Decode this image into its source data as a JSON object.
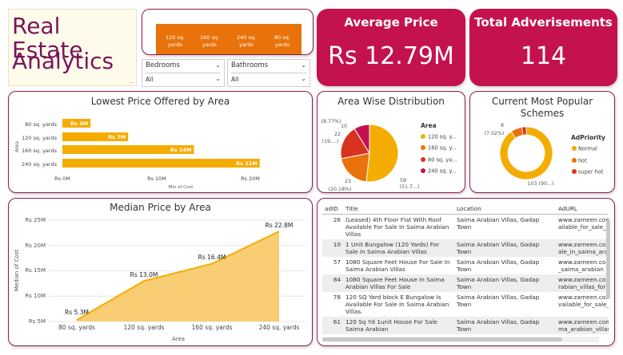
{
  "header": {
    "title_line1": "Real Estate",
    "title_line2": "Analytics",
    "title_footnote": "..."
  },
  "area_slicer": {
    "buttons": [
      "120 sq.\nyards",
      "160 sq.\nyards",
      "240 sq.\nyards",
      "80 sq.\nyards"
    ]
  },
  "filters": {
    "bedrooms": {
      "label": "Bedrooms",
      "value": "All"
    },
    "bathrooms": {
      "label": "Bathrooms",
      "value": "All"
    }
  },
  "kpis": {
    "average_price": {
      "label": "Average Price",
      "value": "Rs 12.79M"
    },
    "total_ads": {
      "label": "Total Adverisements",
      "value": "114"
    }
  },
  "colors": {
    "accent": "#c4124f",
    "border": "#8e1a4c",
    "bar": "#f5ac00",
    "slicer": "#e9720a",
    "title": "#7a1559"
  },
  "lowest_price": {
    "title": "Lowest Price Offered by Area",
    "ylabel": "Area",
    "xlabel": "Min of Cost",
    "x_ticks": [
      "Rs 0M",
      "Rs 10M",
      "Rs 20M"
    ],
    "categories": [
      "80 sq. yards",
      "120 sq. yards",
      "160 sq. yards",
      "240 sq. yards"
    ],
    "labels": [
      "Rs 3M",
      "Rs 7M",
      "Rs 14M",
      "Rs 21M"
    ]
  },
  "area_distribution": {
    "title": "Area Wise Distribution",
    "legend_title": "Area",
    "legend": [
      "120 sq. y...",
      "160 sq. y...",
      "80 sq. ya...",
      "240 sq. y..."
    ],
    "labels": {
      "s120": [
        "59",
        "(51.7...)"
      ],
      "s160": [
        "23",
        "(20.18%)"
      ],
      "s80": [
        "22",
        "(19....)"
      ],
      "s240": [
        "10",
        "(8.77%)"
      ]
    }
  },
  "popular_schemes": {
    "title_line1": "Current Most Popular",
    "title_line2": "Schemes",
    "legend_title": "AdPriority",
    "legend": [
      "Normal",
      "hot",
      "super hot"
    ],
    "labels": {
      "normal": "103 (90...)",
      "hot": "8",
      "hot_pct": "(7.02%)"
    }
  },
  "median_price": {
    "title": "Median Price by Area",
    "ylabel": "Median of Cost",
    "xlabel": "Area",
    "y_ticks": [
      "Rs 25M",
      "Rs 20M",
      "Rs 15M",
      "Rs 10M",
      "Rs 5M"
    ],
    "categories": [
      "80 sq. yards",
      "120 sq. yards",
      "160 sq. yards",
      "240 sq. yards"
    ],
    "labels": [
      "Rs 5.3M",
      "Rs 13.0M",
      "Rs 16.4M",
      "Rs 22.8M"
    ]
  },
  "chart_data": [
    {
      "type": "bar",
      "title": "Lowest Price Offered by Area",
      "orientation": "horizontal",
      "categories": [
        "80 sq. yards",
        "120 sq. yards",
        "160 sq. yards",
        "240 sq. yards"
      ],
      "values": [
        3,
        7,
        14,
        21
      ],
      "xlabel": "Min of Cost",
      "ylabel": "Area",
      "xlim": [
        0,
        22
      ],
      "grid": false
    },
    {
      "type": "pie",
      "title": "Area Wise Distribution",
      "categories": [
        "120 sq. yards",
        "160 sq. yards",
        "80 sq. yards",
        "240 sq. yards"
      ],
      "values": [
        59,
        23,
        22,
        10
      ],
      "colors": [
        "#f5ac00",
        "#e9720a",
        "#d9321f",
        "#c4124f"
      ],
      "legend": "right"
    },
    {
      "type": "pie",
      "title": "Current Most Popular Schemes",
      "donut": true,
      "categories": [
        "Normal",
        "hot",
        "super hot"
      ],
      "values": [
        103,
        8,
        3
      ],
      "colors": [
        "#f5ac00",
        "#e9720a",
        "#d9321f"
      ],
      "legend": "right"
    },
    {
      "type": "area",
      "title": "Median Price by Area",
      "categories": [
        "80 sq. yards",
        "120 sq. yards",
        "160 sq. yards",
        "240 sq. yards"
      ],
      "values": [
        5.3,
        13.0,
        16.4,
        22.8
      ],
      "xlabel": "Area",
      "ylabel": "Median of Cost",
      "ylim": [
        5,
        25
      ],
      "grid": true
    }
  ],
  "ads_table": {
    "columns": [
      "adID",
      "Title",
      "Location",
      "AdURL"
    ],
    "rows": [
      {
        "id": "26",
        "title": "(Leased) 4th Floor Flat With Roof Available For Sale In Saima Arabian Villas",
        "location": "Saima Arabian Villas, Gadap Town",
        "url": "www.zameen.com ailable_for_sale_in"
      },
      {
        "id": "10",
        "title": "1 Unit Bungalow (120 Yards) For Sale In Saima Arabian Villas",
        "location": "Saima Arabian Villas, Gadap Town",
        "url": "www.zameen.com ale_in_saima_ara"
      },
      {
        "id": "57",
        "title": "1080 Square Feet House For Sale In Saima Arabian Villas",
        "location": "Saima Arabian Villas, Gadap Town",
        "url": "www.zameen.com _saima_arabian"
      },
      {
        "id": "84",
        "title": "1080 Square Feet House In Saima Arabian Villas For Sale",
        "location": "Saima Arabian Villas, Gadap Town",
        "url": "www.zameen.com rabian_villas_for"
      },
      {
        "id": "78",
        "title": "120 SQ Yard block E Bungalow Is Available For Sale In Saima Arabian Villas.",
        "location": "Saima Arabian Villas, Gadap Town",
        "url": "www.zameen.com vailable_for_sale_i"
      },
      {
        "id": "61",
        "title": "120 Sq Yd 1unit House For Sale Saima Arabian",
        "location": "Saima Arabian Villas, Gadap Town",
        "url": "www.zameen.com ma_arabian_villas"
      }
    ]
  }
}
